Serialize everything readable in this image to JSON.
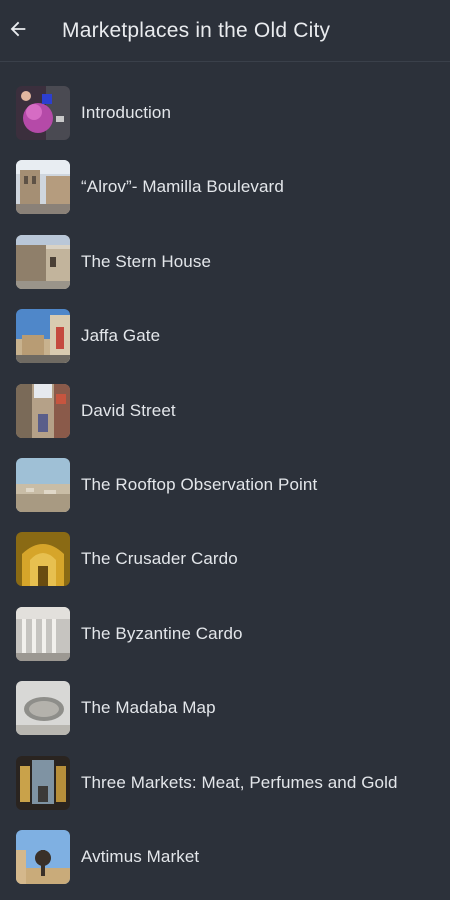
{
  "header": {
    "title": "Marketplaces in the Old City",
    "back_icon": "arrow-left-icon"
  },
  "colors": {
    "background": "#2c313a",
    "text": "#e3e6ea",
    "divider": "#3a404a"
  },
  "items": [
    {
      "label": "Introduction",
      "thumb": "intro"
    },
    {
      "label": "“Alrov”- Mamilla Boulevard",
      "thumb": "mamilla"
    },
    {
      "label": "The Stern House",
      "thumb": "stern"
    },
    {
      "label": "Jaffa Gate",
      "thumb": "jaffa"
    },
    {
      "label": "David Street",
      "thumb": "david"
    },
    {
      "label": "The Rooftop Observation Point",
      "thumb": "rooftop"
    },
    {
      "label": "The Crusader Cardo",
      "thumb": "crusader"
    },
    {
      "label": "The Byzantine Cardo",
      "thumb": "byzantine"
    },
    {
      "label": "The Madaba Map",
      "thumb": "madaba"
    },
    {
      "label": "Three Markets: Meat, Perfumes and Gold",
      "thumb": "markets"
    },
    {
      "label": "Avtimus Market",
      "thumb": "avtimus"
    }
  ]
}
